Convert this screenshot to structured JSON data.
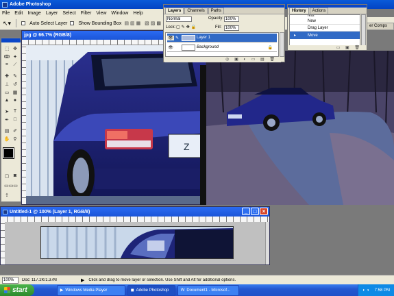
{
  "app": {
    "title": "Adobe Photoshop"
  },
  "menu": [
    "File",
    "Edit",
    "Image",
    "Layer",
    "Select",
    "Filter",
    "View",
    "Window",
    "Help"
  ],
  "options": {
    "auto_select": "Auto Select Layer",
    "bounding_box": "Show Bounding Box",
    "comps_tab": "er Comps"
  },
  "doc1": {
    "title": "jpg @ 66.7% (RGB/8)"
  },
  "doc2": {
    "title": "Untitled-1 @ 100% (Layer 1, RGB/8)"
  },
  "layers": {
    "tabs": [
      "Layers",
      "Channels",
      "Paths"
    ],
    "blend_mode": "Normal",
    "opacity_label": "Opacity:",
    "opacity": "100%",
    "lock_label": "Lock:",
    "fill_label": "Fill:",
    "fill": "100%",
    "items": [
      "Layer 1",
      "Background"
    ]
  },
  "history": {
    "tabs": [
      "History",
      "Actions"
    ],
    "items": [
      "New",
      "Drag Layer",
      "Move"
    ],
    "partial_top": "ress"
  },
  "status": {
    "zoom": "100%",
    "doc": "Doc: 117.2K/1.37M",
    "hint": "Click and drag to move layer or selection. Use Shift and Alt for additional options."
  },
  "taskbar": {
    "start": "start",
    "tasks": [
      "Windows Media Player",
      "Adobe Photoshop",
      "Document1 - Microsof..."
    ],
    "time": "7:58 PM"
  }
}
